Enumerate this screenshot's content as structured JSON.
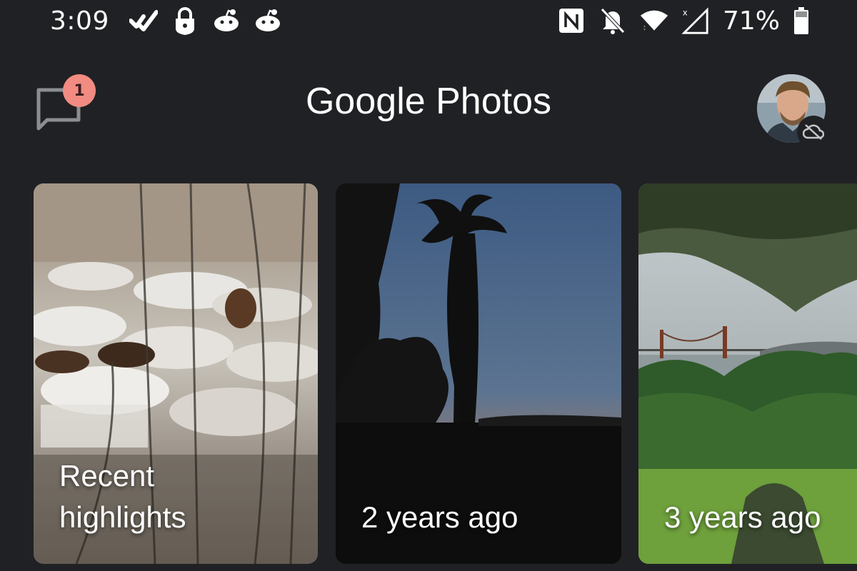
{
  "status_bar": {
    "time": "3:09",
    "left_icons": [
      "check-icon",
      "lock-icon",
      "reddit-icon",
      "reddit-icon"
    ],
    "right_icons": [
      "nfc-icon",
      "bell-off-icon",
      "wifi-icon",
      "signal-icon"
    ],
    "battery_percent": "71%"
  },
  "header": {
    "title_google": "Google",
    "title_photos": "Photos",
    "messages_badge": "1"
  },
  "memories": [
    {
      "label_line1": "Recent",
      "label_line2": "highlights"
    },
    {
      "label_line1": "2 years ago",
      "label_line2": ""
    },
    {
      "label_line1": "3 years ago",
      "label_line2": ""
    }
  ],
  "colors": {
    "background": "#202124",
    "badge": "#f28b82",
    "text": "#ffffff"
  }
}
